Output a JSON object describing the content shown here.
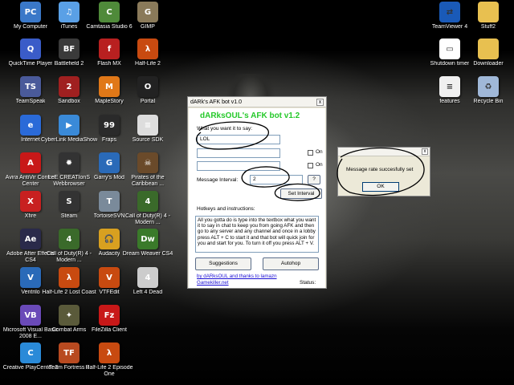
{
  "desktop": {
    "left_icons": [
      {
        "label": "My Computer",
        "icon": "my-computer-icon",
        "color": "#3a78c8",
        "glyph": "PC"
      },
      {
        "label": "iTunes",
        "icon": "itunes-icon",
        "color": "#5aa0e6",
        "glyph": "♫"
      },
      {
        "label": "Camtasia Studio 6",
        "icon": "camtasia-icon",
        "color": "#4f8a3a",
        "glyph": "C"
      },
      {
        "label": "GIMP",
        "icon": "gimp-icon",
        "color": "#8a7a5a",
        "glyph": "G"
      },
      {
        "label": "QuickTime Player",
        "icon": "quicktime-icon",
        "color": "#3a5cc8",
        "glyph": "Q"
      },
      {
        "label": "Battlefield 2",
        "icon": "battlefield-icon",
        "color": "#3a3a3a",
        "glyph": "BF"
      },
      {
        "label": "Flash MX",
        "icon": "flash-icon",
        "color": "#b82020",
        "glyph": "f"
      },
      {
        "label": "Half-Life 2",
        "icon": "half-life-icon",
        "color": "#c84a10",
        "glyph": "λ"
      },
      {
        "label": "TeamSpeak",
        "icon": "teamspeak-icon",
        "color": "#4a5a9a",
        "glyph": "TS"
      },
      {
        "label": "Sandbox",
        "icon": "sandbox-icon",
        "color": "#a02020",
        "glyph": "2"
      },
      {
        "label": "MapleStory",
        "icon": "maplestory-icon",
        "color": "#e07818",
        "glyph": "M"
      },
      {
        "label": "Portal",
        "icon": "portal-icon",
        "color": "#222222",
        "glyph": "O"
      },
      {
        "label": "Internet",
        "icon": "internet-icon",
        "color": "#2a6ad8",
        "glyph": "e"
      },
      {
        "label": "CyberLink MediaShow",
        "icon": "mediashow-icon",
        "color": "#3a8ad8",
        "glyph": "▶"
      },
      {
        "label": "Fraps",
        "icon": "fraps-icon",
        "color": "#2a2a2a",
        "glyph": "99"
      },
      {
        "label": "Source SDK",
        "icon": "source-sdk-icon",
        "color": "#dddddd",
        "glyph": "≡"
      },
      {
        "label": "Avira AntiVir Control Center",
        "icon": "avira-icon",
        "color": "#c81818",
        "glyph": "A"
      },
      {
        "label": "LeE CREATIonS Webbrowser",
        "icon": "webbrowser-icon",
        "color": "#333333",
        "glyph": "✹"
      },
      {
        "label": "Garry's Mod",
        "icon": "garrys-mod-icon",
        "color": "#2a6ab8",
        "glyph": "G"
      },
      {
        "label": "Pirates of the Caribbean ...",
        "icon": "pirates-icon",
        "color": "#6a4a2a",
        "glyph": "☠"
      },
      {
        "label": "Xfire",
        "icon": "xfire-icon",
        "color": "#c82020",
        "glyph": "X"
      },
      {
        "label": "Steam",
        "icon": "steam-icon",
        "color": "#333333",
        "glyph": "S"
      },
      {
        "label": "TortoiseSVN",
        "icon": "tortoisesvn-icon",
        "color": "#7a8a9a",
        "glyph": "T"
      },
      {
        "label": "Call of Duty(R) 4 - Modern ...",
        "icon": "call-of-duty-icon",
        "color": "#3a6a2a",
        "glyph": "4"
      },
      {
        "label": "Adobe After Effects CS4",
        "icon": "after-effects-icon",
        "color": "#2a2a4a",
        "glyph": "Ae"
      },
      {
        "label": "Call of Duty(R) 4 - Modern ...",
        "icon": "call-of-duty-icon",
        "color": "#3a6a2a",
        "glyph": "4"
      },
      {
        "label": "Audacity",
        "icon": "audacity-icon",
        "color": "#d8a020",
        "glyph": "🎧"
      },
      {
        "label": "Dream Weaver CS4",
        "icon": "dreamweaver-icon",
        "color": "#3a7a2a",
        "glyph": "Dw"
      },
      {
        "label": "Ventrilo",
        "icon": "ventrilo-icon",
        "color": "#2a6ab8",
        "glyph": "V"
      },
      {
        "label": "Half-Life 2 Lost Coast",
        "icon": "half-life-icon",
        "color": "#c84a10",
        "glyph": "λ"
      },
      {
        "label": "VTFEdit",
        "icon": "vtfedit-icon",
        "color": "#c84a10",
        "glyph": "V"
      },
      {
        "label": "Left 4 Dead",
        "icon": "left4dead-icon",
        "color": "#cccccc",
        "glyph": "4"
      },
      {
        "label": "Microsoft Visual Basic 2008 E...",
        "icon": "visual-basic-icon",
        "color": "#6a4ab8",
        "glyph": "VB"
      },
      {
        "label": "Combat Arms",
        "icon": "combat-arms-icon",
        "color": "#5a5a3a",
        "glyph": "✦"
      },
      {
        "label": "FileZilla Client",
        "icon": "filezilla-icon",
        "color": "#c81818",
        "glyph": "Fz"
      },
      {
        "label": "",
        "icon": "",
        "color": "",
        "glyph": ""
      },
      {
        "label": "Creative PlayCenter 2",
        "icon": "playcenter-icon",
        "color": "#2a8ad8",
        "glyph": "C"
      },
      {
        "label": "Team Fortress 2",
        "icon": "team-fortress-icon",
        "color": "#b84a20",
        "glyph": "TF"
      },
      {
        "label": "Half-Life 2 Episode One",
        "icon": "half-life-icon",
        "color": "#c84a10",
        "glyph": "λ"
      }
    ],
    "right_icons": [
      {
        "label": "TeamViewer 4",
        "icon": "teamviewer-icon",
        "color": "#1a5ab8",
        "glyph": "⇄"
      },
      {
        "label": "Stuff2",
        "icon": "folder-icon",
        "color": "#e8c050",
        "glyph": ""
      },
      {
        "label": "Shutdown timer",
        "icon": "shutdown-timer-icon",
        "color": "#ffffff",
        "glyph": "▭"
      },
      {
        "label": "Downloader",
        "icon": "folder-icon",
        "color": "#e8c050",
        "glyph": ""
      },
      {
        "label": "features",
        "icon": "document-icon",
        "color": "#f0f0f0",
        "glyph": "≡"
      },
      {
        "label": "Recycle Bin",
        "icon": "recycle-bin-icon",
        "color": "#a0b8d8",
        "glyph": "♻"
      }
    ]
  },
  "bot_window": {
    "title": "dARk's AFK bot v1.0",
    "close": "x",
    "heading": "dARksOUL's AFK bot v1.2",
    "what_label": "What you want it to say:",
    "say_value": "LOL",
    "on_label": "On",
    "interval_label": "Message Interval:",
    "interval_value": "2",
    "help_button": "?",
    "set_interval_button": "Set Interval",
    "hotkeys_label": "Hotkeys and instructions:",
    "instructions": "All you gotta do is type into the textbox what you want it to say in chat to keep you from going AFK and then go to any server and any channel and once in a lobby press ALT + C to start it and that bot will quick join for you and start for you. To turn it off you press ALT + V.",
    "suggestions_button": "Suggestions",
    "autohop_button": "Autohop",
    "credit_line": "by dARksOUL and thanks to lamazn",
    "credit_site": "Gamekiller.net",
    "status_label": "Status:"
  },
  "message_box": {
    "close": "x",
    "message": "Message rate succesfully set",
    "ok_button": "OK"
  }
}
